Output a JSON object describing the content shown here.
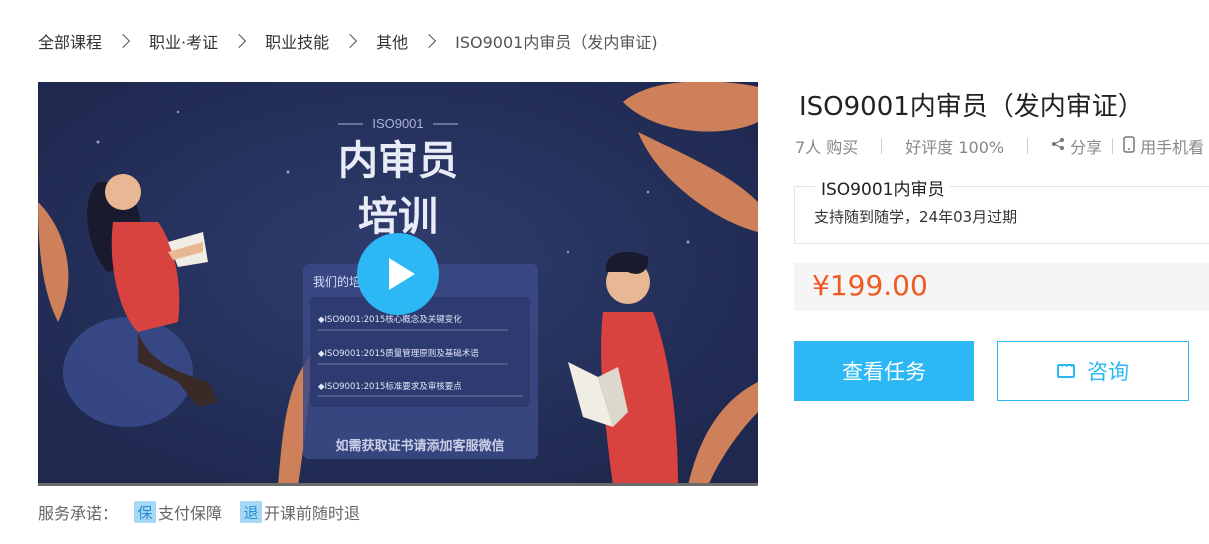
{
  "breadcrumb": {
    "items": [
      "全部课程",
      "职业·考证",
      "职业技能",
      "其他"
    ],
    "current": "ISO9001内审员（发内审证)"
  },
  "video": {
    "poster": {
      "subtitle": "ISO9001",
      "title_line1": "内审员",
      "title_line2": "培训",
      "panel_title": "我们的培",
      "bullets": [
        "◆ISO9001:2015核心概念及关键变化",
        "◆ISO9001:2015质量管理原则及基础术语",
        "◆ISO9001:2015标准要求及审核要点"
      ],
      "footer": "如需获取证书请添加客服微信"
    },
    "play_icon": "play-icon"
  },
  "services": {
    "label": "服务承诺：",
    "items": [
      {
        "badge": "保",
        "text": "支付保障"
      },
      {
        "badge": "退",
        "text": "开课前随时退"
      }
    ]
  },
  "course": {
    "title": "ISO9001内审员（发内审证）",
    "buyers": "7人 购买",
    "rating": "好评度 100%",
    "share": "分享",
    "mobile": "用手机看",
    "spec_name": "ISO9001内审员",
    "spec_desc": "支持随到随学，24年03月过期",
    "price": "¥199.00",
    "view_tasks": "查看任务",
    "consult": "咨询"
  },
  "colors": {
    "accent": "#2bb8f4",
    "price": "#ee5a24",
    "video_bg": "#232e57"
  }
}
